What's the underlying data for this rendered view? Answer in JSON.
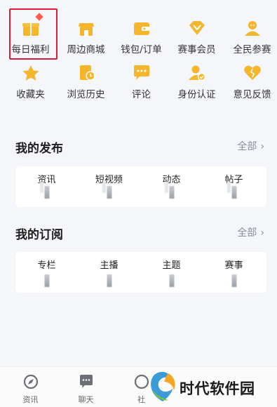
{
  "grid": {
    "row1": [
      {
        "label": "每日福利",
        "icon": "gift-icon"
      },
      {
        "label": "周边商城",
        "icon": "shop-icon"
      },
      {
        "label": "钱包/订单",
        "icon": "wallet-icon"
      },
      {
        "label": "赛事会员",
        "icon": "diamond-icon"
      },
      {
        "label": "全民参赛",
        "icon": "people-icon"
      }
    ],
    "row2": [
      {
        "label": "收藏夹",
        "icon": "star-icon"
      },
      {
        "label": "浏览历史",
        "icon": "history-icon"
      },
      {
        "label": "评论",
        "icon": "comment-icon"
      },
      {
        "label": "身份认证",
        "icon": "id-verify-icon"
      },
      {
        "label": "意见反馈",
        "icon": "feedback-icon"
      }
    ]
  },
  "publish": {
    "title": "我的发布",
    "more": "全部",
    "stats": [
      "资讯",
      "短视频",
      "动态",
      "帖子"
    ]
  },
  "subscribe": {
    "title": "我的订阅",
    "more": "全部",
    "stats": [
      "专栏",
      "主播",
      "主题",
      "赛事"
    ]
  },
  "tabbar": [
    {
      "label": "资讯",
      "icon": "news-icon"
    },
    {
      "label": "聊天",
      "icon": "chat-icon"
    },
    {
      "label": "社",
      "icon": "community-icon"
    }
  ],
  "watermark": "时代软件园",
  "colors": {
    "accent": "#f5b62b",
    "highlight": "#d81e3a",
    "dot": "#ff5a4a"
  }
}
